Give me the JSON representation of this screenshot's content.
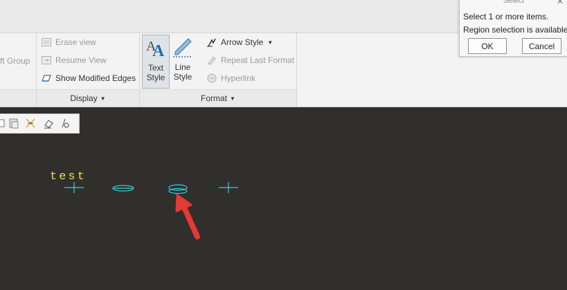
{
  "ribbon": {
    "draft_group_partial": "ft Group",
    "display": {
      "erase_view": "Erase view",
      "resume_view": "Resume View",
      "show_modified_edges": "Show Modified Edges",
      "footer": "Display"
    },
    "text_style": {
      "line1": "Text",
      "line2": "Style"
    },
    "line_style": {
      "line1": "Line",
      "line2": "Style"
    },
    "format": {
      "arrow_style": "Arrow Style",
      "repeat_last_format": "Repeat Last Format",
      "hyperlink": "Hyperlink",
      "footer": "Format"
    }
  },
  "select_dialog": {
    "title": "Select",
    "line1": "Select 1 or more items.",
    "line2": "Region selection is available.",
    "ok": "OK",
    "cancel": "Cancel"
  },
  "canvas": {
    "note_text": "test",
    "colors": {
      "background": "#312f2b",
      "note": "#e8e04a",
      "entity": "#2ad4e0",
      "arrow": "#e53935"
    }
  },
  "icons": [
    "erase-view-icon",
    "resume-view-icon",
    "show-modified-edges-icon",
    "text-style-icon",
    "line-style-icon",
    "arrow-style-icon",
    "repeat-last-format-icon",
    "hyperlink-icon"
  ]
}
